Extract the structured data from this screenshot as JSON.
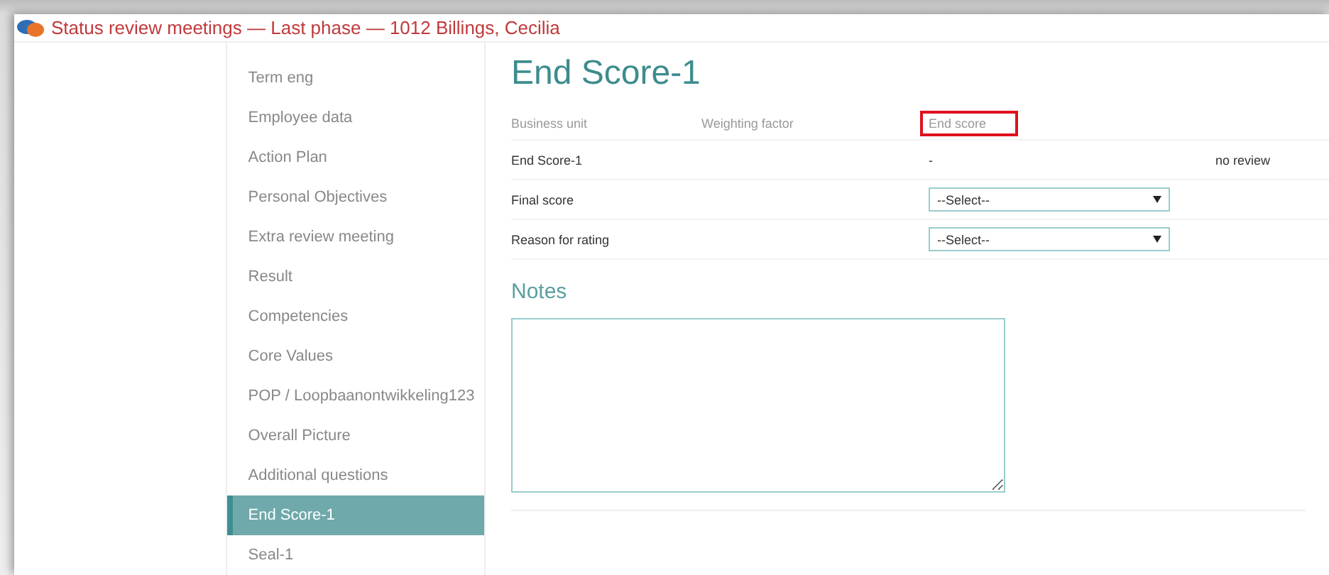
{
  "window": {
    "title": "Status review meetings — Last phase — 1012 Billings, Cecilia"
  },
  "sidebar": {
    "items": [
      {
        "label": "Term eng",
        "selected": false
      },
      {
        "label": "Employee data",
        "selected": false
      },
      {
        "label": "Action Plan",
        "selected": false
      },
      {
        "label": "Personal Objectives",
        "selected": false
      },
      {
        "label": "Extra review meeting",
        "selected": false
      },
      {
        "label": "Result",
        "selected": false
      },
      {
        "label": "Competencies",
        "selected": false
      },
      {
        "label": "Core Values",
        "selected": false
      },
      {
        "label": "POP / Loopbaanontwikkeling123",
        "selected": false
      },
      {
        "label": "Overall Picture",
        "selected": false
      },
      {
        "label": "Additional questions",
        "selected": false
      },
      {
        "label": "End Score-1",
        "selected": true
      },
      {
        "label": "Seal-1",
        "selected": false
      }
    ]
  },
  "main": {
    "heading": "End Score-1",
    "columns": [
      {
        "label": "Business unit",
        "highlighted": false
      },
      {
        "label": "Weighting factor",
        "highlighted": false
      },
      {
        "label": "End score",
        "highlighted": true
      }
    ],
    "rows": [
      {
        "kind": "text",
        "label": "End Score-1",
        "value": "-",
        "note": "no review"
      },
      {
        "kind": "select",
        "label": "Final score",
        "value": "--Select--"
      },
      {
        "kind": "select",
        "label": "Reason for rating",
        "value": "--Select--"
      }
    ],
    "notes": {
      "heading": "Notes"
    }
  }
}
